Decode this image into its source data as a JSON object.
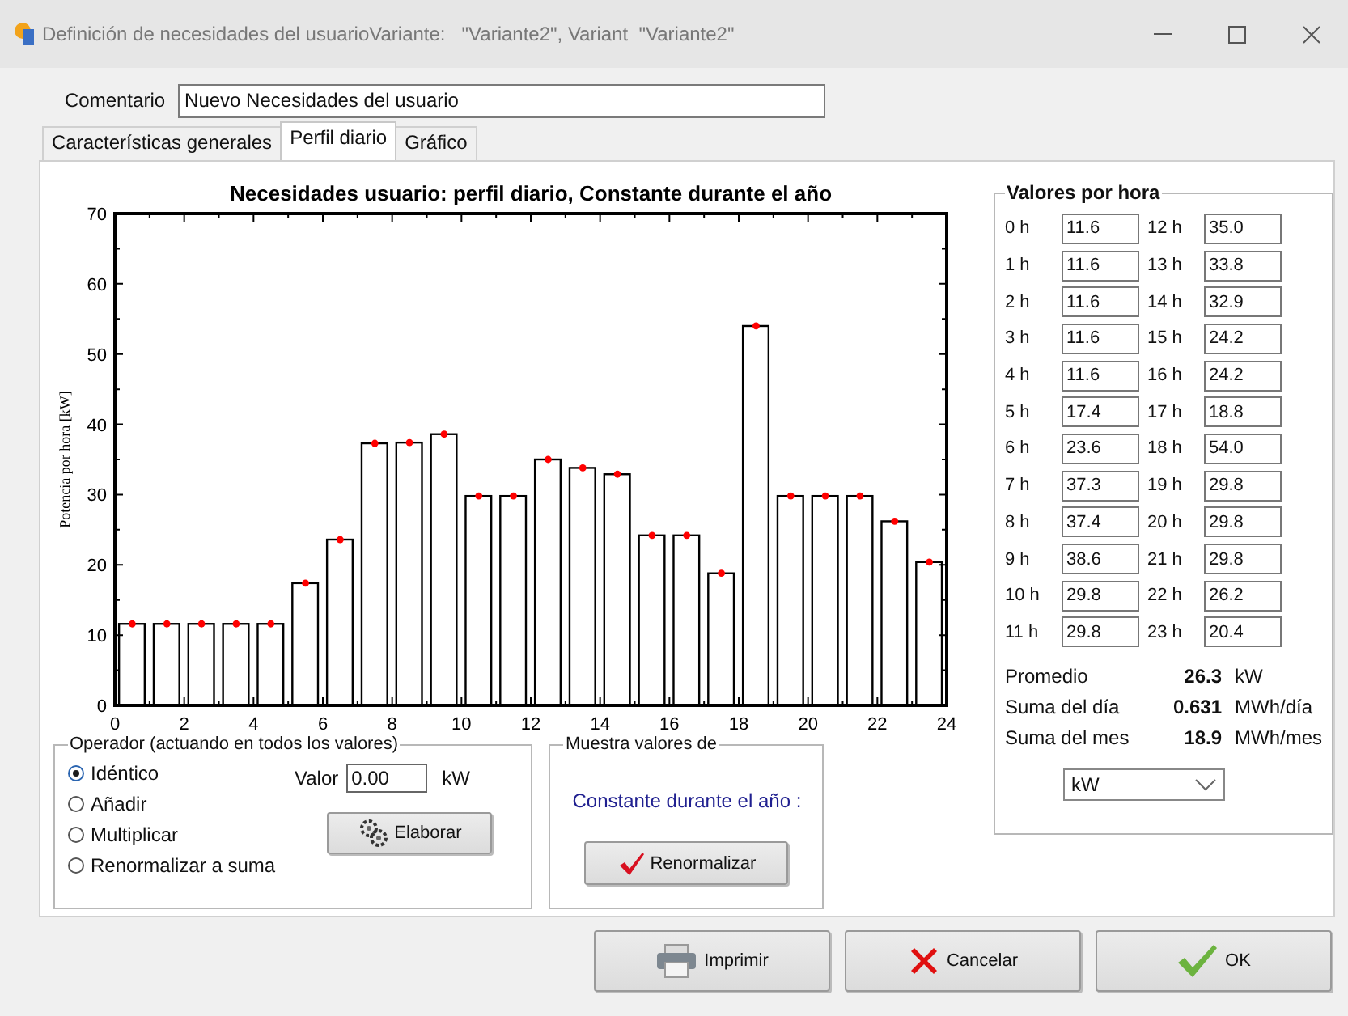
{
  "window": {
    "title": "Definición de necesidades del usuarioVariante:   \"Variante2\", Variant  \"Variante2\""
  },
  "comment": {
    "label": "Comentario",
    "value": "Nuevo Necesidades del usuario"
  },
  "tabs": [
    {
      "label": "Características generales",
      "selected": false
    },
    {
      "label": "Perfil diario",
      "selected": true
    },
    {
      "label": "Gráfico",
      "selected": false
    }
  ],
  "chart": {
    "chart_data": {
      "type": "bar",
      "title": "Necesidades usuario: perfil diario, Constante durante el año",
      "ylabel": "Potencia por hora [kW]",
      "x": [
        0.5,
        1.5,
        2.5,
        3.5,
        4.5,
        5.5,
        6.5,
        7.5,
        8.5,
        9.5,
        10.5,
        11.5,
        12.5,
        13.5,
        14.5,
        15.5,
        16.5,
        17.5,
        18.5,
        19.5,
        20.5,
        21.5,
        22.5,
        23.5
      ],
      "values": [
        11.6,
        11.6,
        11.6,
        11.6,
        11.6,
        17.4,
        23.6,
        37.3,
        37.4,
        38.6,
        29.8,
        29.8,
        35.0,
        33.8,
        32.9,
        24.2,
        24.2,
        18.8,
        54.0,
        29.8,
        29.8,
        29.8,
        26.2,
        20.4
      ],
      "xlim": [
        0,
        24
      ],
      "ylim": [
        0,
        70
      ],
      "xticks": [
        0,
        2,
        4,
        6,
        8,
        10,
        12,
        14,
        16,
        18,
        20,
        22,
        24
      ],
      "yticks": [
        0,
        10,
        20,
        30,
        40,
        50,
        60,
        70
      ]
    }
  },
  "operator": {
    "title": "Operador (actuando en todos los valores)",
    "options": [
      {
        "label": "Idéntico",
        "selected": true
      },
      {
        "label": "Añadir",
        "selected": false
      },
      {
        "label": "Multiplicar",
        "selected": false
      },
      {
        "label": "Renormalizar a suma",
        "selected": false
      }
    ],
    "value_label": "Valor",
    "value": "0.00",
    "unit": "kW",
    "apply_button": "Elaborar"
  },
  "sample": {
    "title": "Muestra valores de",
    "text": "Constante durante el año :",
    "button": "Renormalizar"
  },
  "hourly": {
    "title": "Valores por hora",
    "hours": [
      {
        "label": "0 h",
        "value": "11.6"
      },
      {
        "label": "1 h",
        "value": "11.6"
      },
      {
        "label": "2 h",
        "value": "11.6"
      },
      {
        "label": "3 h",
        "value": "11.6"
      },
      {
        "label": "4 h",
        "value": "11.6"
      },
      {
        "label": "5 h",
        "value": "17.4"
      },
      {
        "label": "6 h",
        "value": "23.6"
      },
      {
        "label": "7 h",
        "value": "37.3"
      },
      {
        "label": "8 h",
        "value": "37.4"
      },
      {
        "label": "9 h",
        "value": "38.6"
      },
      {
        "label": "10 h",
        "value": "29.8"
      },
      {
        "label": "11 h",
        "value": "29.8"
      },
      {
        "label": "12 h",
        "value": "35.0"
      },
      {
        "label": "13 h",
        "value": "33.8"
      },
      {
        "label": "14 h",
        "value": "32.9"
      },
      {
        "label": "15 h",
        "value": "24.2"
      },
      {
        "label": "16 h",
        "value": "24.2"
      },
      {
        "label": "17 h",
        "value": "18.8"
      },
      {
        "label": "18 h",
        "value": "54.0"
      },
      {
        "label": "19 h",
        "value": "29.8"
      },
      {
        "label": "20 h",
        "value": "29.8"
      },
      {
        "label": "21 h",
        "value": "29.8"
      },
      {
        "label": "22 h",
        "value": "26.2"
      },
      {
        "label": "23 h",
        "value": "20.4"
      }
    ],
    "summary": [
      {
        "label": "Promedio",
        "value": "26.3",
        "unit": "kW"
      },
      {
        "label": "Suma del día",
        "value": "0.631",
        "unit": "MWh/día"
      },
      {
        "label": "Suma del mes",
        "value": "18.9",
        "unit": "MWh/mes"
      }
    ],
    "unit_select": "kW"
  },
  "buttons": [
    {
      "label": "Imprimir",
      "kind": "print"
    },
    {
      "label": "Cancelar",
      "kind": "cancel"
    },
    {
      "label": "OK",
      "kind": "ok"
    }
  ]
}
